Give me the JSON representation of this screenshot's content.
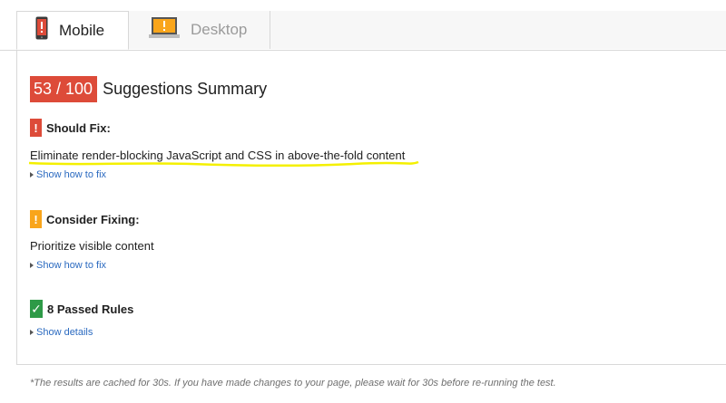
{
  "tabs": [
    {
      "label": "Mobile",
      "icon": "mobile-phone-icon",
      "active": true
    },
    {
      "label": "Desktop",
      "icon": "desktop-monitor-icon",
      "active": false
    }
  ],
  "score": {
    "value": "53 / 100",
    "title": "Suggestions Summary"
  },
  "should_fix": {
    "heading": "Should Fix:",
    "flag": "!",
    "rule": "Eliminate render-blocking JavaScript and CSS in above-the-fold content",
    "link": "Show how to fix"
  },
  "consider_fixing": {
    "heading": "Consider Fixing:",
    "flag": "!",
    "rule": "Prioritize visible content",
    "link": "Show how to fix"
  },
  "passed": {
    "heading": "8 Passed Rules",
    "flag": "✓",
    "link": "Show details"
  },
  "footnote": "*The results are cached for 30s. If you have made changes to your page, please wait for 30s before re-running the test.",
  "colors": {
    "score_red": "#dd4b39",
    "warn_orange": "#f9a51b",
    "pass_green": "#2e9a47",
    "link_blue": "#2b6ac0",
    "highlight_yellow": "#f4f000"
  }
}
